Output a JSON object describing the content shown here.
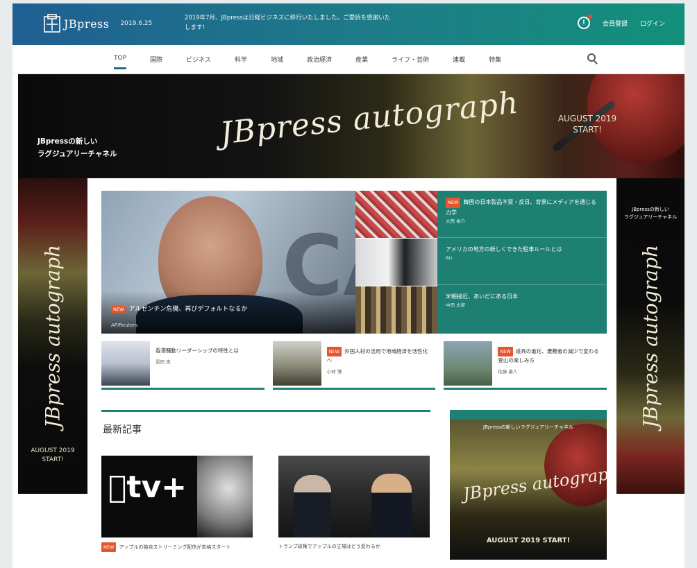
{
  "header": {
    "logo": "JBpress",
    "date": "2019.6.25",
    "notice": "2019年7月、JBpressは日経ビジネスに移行いたしました。ご愛読を感謝いたします！",
    "notifications_label": "!",
    "links": [
      "会員登録",
      "ログイン"
    ]
  },
  "nav": {
    "items": [
      "TOP",
      "国際",
      "ビジネス",
      "科学",
      "地域",
      "政治経済",
      "産業",
      "ライフ・芸術",
      "連載",
      "特集"
    ],
    "active": "TOP"
  },
  "banner": {
    "copy": [
      "JBpressの新しい",
      "ラグジュアリーチャネル"
    ],
    "script": "JBpress autograph",
    "tagline": [
      "AUGUST 2019",
      "START!"
    ]
  },
  "side_left": {
    "script": "JBpress autograph",
    "tagline": [
      "AUGUST 2019",
      "START!"
    ]
  },
  "side_right": {
    "top": [
      "JBpressの新しい",
      "ラグジュアリーチャネル"
    ],
    "script": "JBpress autograph"
  },
  "hero": {
    "badge": "NEW",
    "title": "アルゼンチン危機、再びデフォルトなるか",
    "credit": "AP/Reuters"
  },
  "teal_items": [
    {
      "badge": "NEW",
      "title": "韓国の日本製品不買・反日、背景にメディアを通じる力学",
      "author": "大西 裕介"
    },
    {
      "badge": "",
      "title": "アメリカの地方の新しくできた駐車ルールとは",
      "author": "Biz"
    },
    {
      "badge": "",
      "title": "米朝接近、あいだにある日本",
      "author": "中田 太郎"
    }
  ],
  "cards": [
    {
      "badge": "",
      "title": "香港騒動リーダーシップの特性とは",
      "author": "黒田 実"
    },
    {
      "badge": "NEW",
      "title": "外国人材の活用で地域経済を活性化へ",
      "author": "小林 博"
    },
    {
      "badge": "NEW",
      "title": "道具の進化、遭難者の減少で変わる登山の楽しみ方",
      "author": "佐藤 康人"
    }
  ],
  "latest": {
    "heading": "最新記事",
    "articles": [
      {
        "badge": "NEW",
        "tv": "tv+",
        "caption": "アップルの独自ストリーミング配信が本格スタート"
      },
      {
        "caption": "トランプ政権でアップルの立場はどう変わるか"
      }
    ]
  },
  "ad": {
    "top": "JBpressの新しいラグジュアリーチャネル",
    "script": "JBpress autograph",
    "tagline": "AUGUST 2019 START!"
  }
}
